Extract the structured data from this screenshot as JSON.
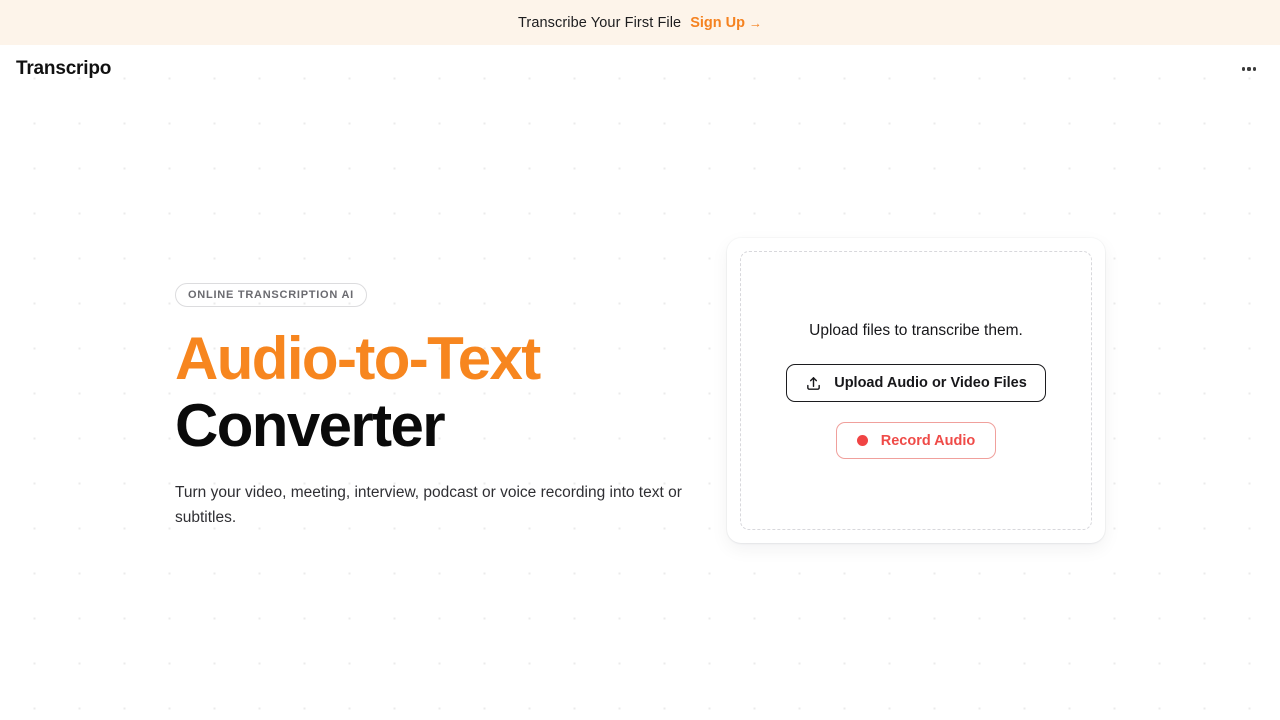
{
  "banner": {
    "message": "Transcribe Your First File",
    "cta_label": "Sign Up",
    "cta_arrow": "→",
    "background_color": "#fdf4ea",
    "cta_color": "#f58220"
  },
  "header": {
    "brand": "Transcripo",
    "menu_icon": "ellipsis-horizontal-icon"
  },
  "hero": {
    "badge": "ONLINE TRANSCRIPTION AI",
    "headline_accent": "Audio-to-Text",
    "headline_plain": "Converter",
    "accent_color": "#f7861f",
    "subheadline": "Turn your video, meeting, interview, podcast or voice recording into text or subtitles."
  },
  "upload": {
    "dropzone_title": "Upload files to transcribe them.",
    "upload_button_label": "Upload Audio or Video Files",
    "upload_button_icon": "upload-icon",
    "record_button_label": "Record Audio",
    "record_button_icon": "record-dot-icon",
    "record_color": "#ef4b48"
  }
}
